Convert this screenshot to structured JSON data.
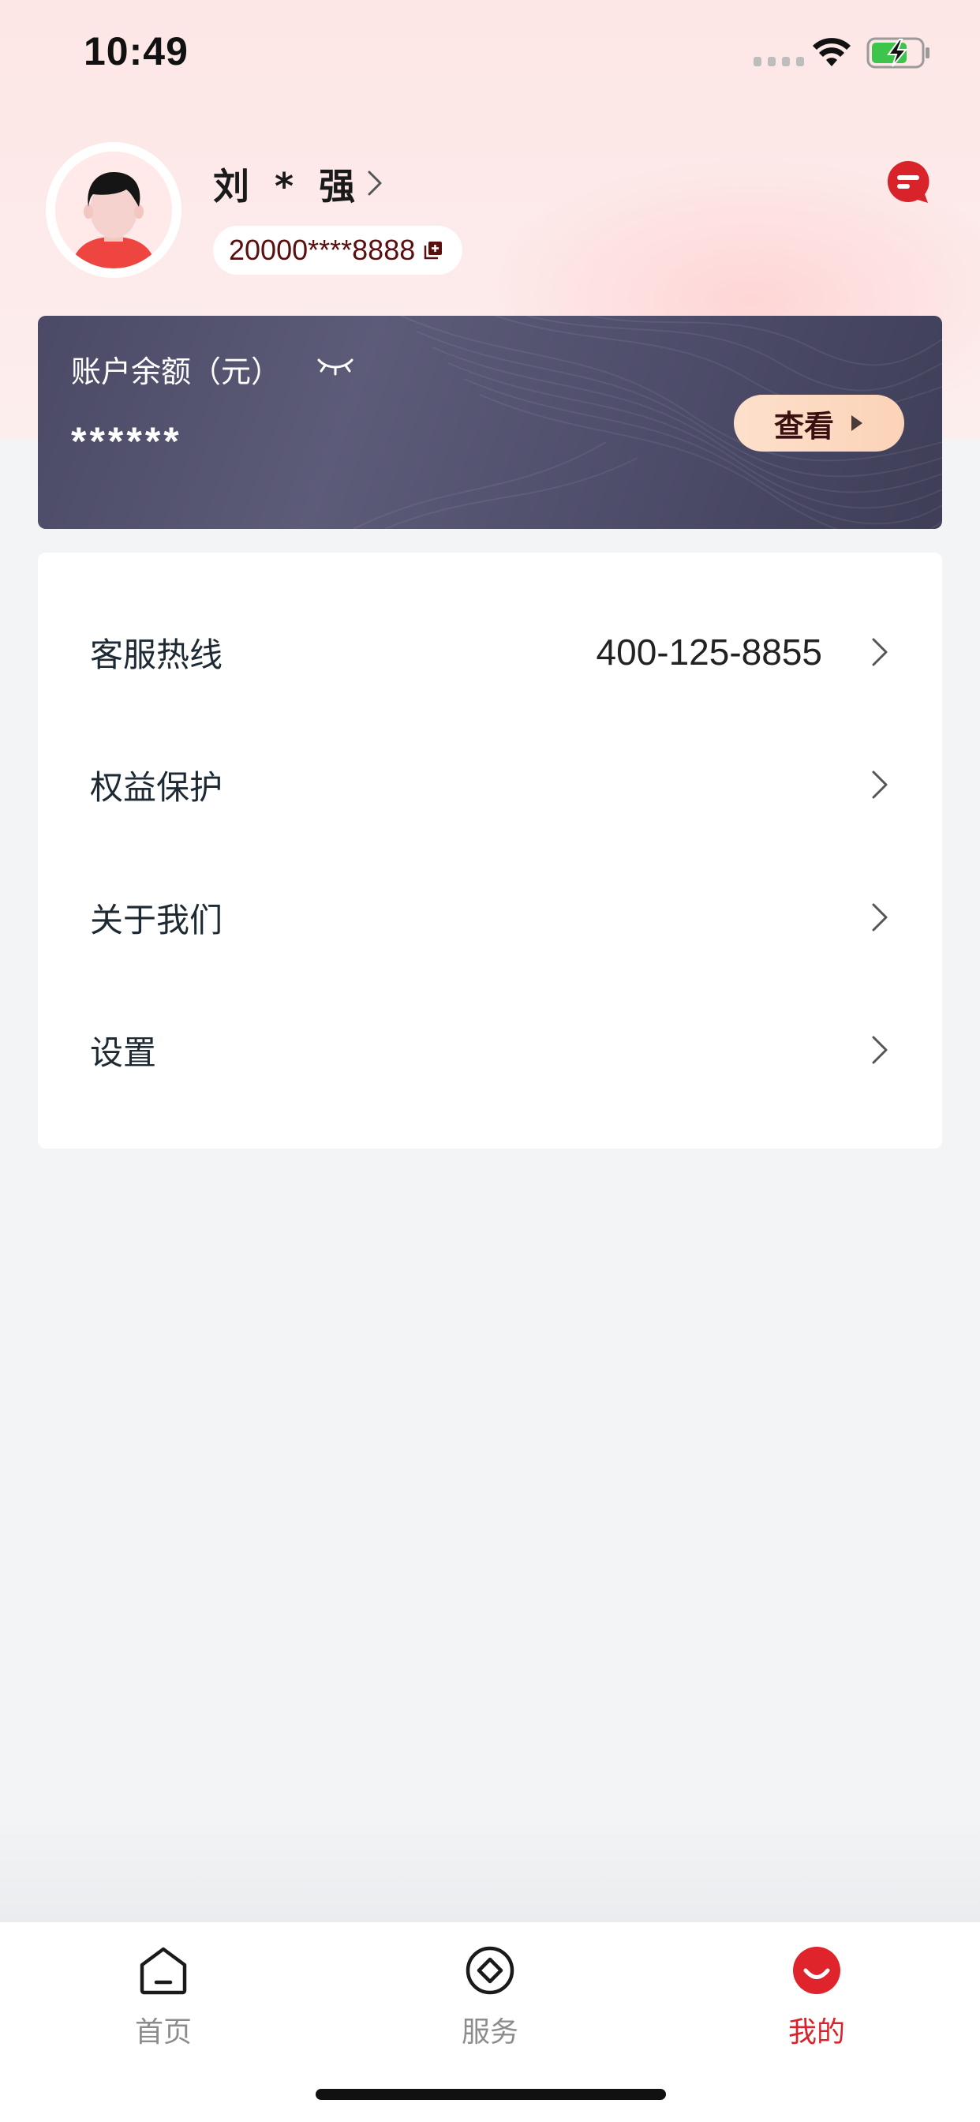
{
  "status_bar": {
    "time": "10:49"
  },
  "profile": {
    "name": "刘 * 强",
    "account_number": "20000****8888"
  },
  "balance": {
    "label": "账户余额（元）",
    "masked_value": "******",
    "view_button_label": "查看"
  },
  "menu": {
    "items": [
      {
        "label": "客服热线",
        "value": "400-125-8855"
      },
      {
        "label": "权益保护"
      },
      {
        "label": "关于我们"
      },
      {
        "label": "设置"
      }
    ]
  },
  "bottom_nav": {
    "items": [
      {
        "label": "首页",
        "icon": "home-icon",
        "active": false
      },
      {
        "label": "服务",
        "icon": "service-icon",
        "active": false
      },
      {
        "label": "我的",
        "icon": "profile-icon",
        "active": true
      }
    ]
  },
  "colors": {
    "brand_red": "#d8232a",
    "card_bg": "#4b4a66",
    "header_pink": "#fde6e6",
    "view_button": "#fbd3b8"
  }
}
